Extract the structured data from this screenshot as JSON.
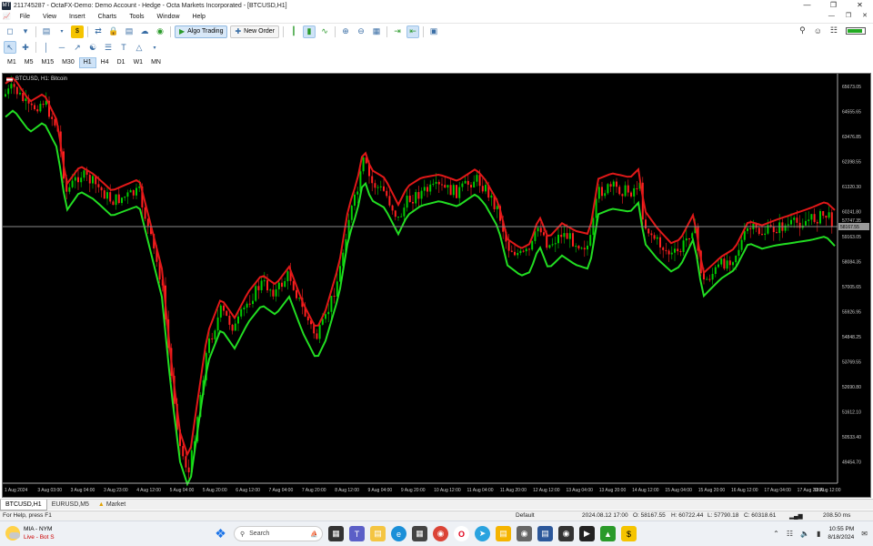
{
  "window": {
    "title": "211745287 - OctaFX-Demo: Demo Account - Hedge - Octa Markets Incorporated - [BTCUSD,H1]",
    "app_icon": "MT"
  },
  "menu": [
    "File",
    "View",
    "Insert",
    "Charts",
    "Tools",
    "Window",
    "Help"
  ],
  "toolbar": {
    "algo_trading": "Algo Trading",
    "new_order": "New Order"
  },
  "timeframes": [
    "M1",
    "M5",
    "M15",
    "M30",
    "H1",
    "H4",
    "D1",
    "W1",
    "MN"
  ],
  "active_timeframe": "H1",
  "chart": {
    "label": "BTCUSD, H1: Bitcoin",
    "price_labels": [
      "65673.05",
      "64555.65",
      "63476.85",
      "62398.55",
      "61320.30",
      "60241.80",
      "59163.05",
      "58084.35",
      "57005.65",
      "55926.95",
      "54848.25",
      "53769.55",
      "52690.80",
      "51612.10",
      "50533.40",
      "49454.70"
    ],
    "current_price": "58167.55",
    "current_price_line": "57747.35",
    "time_labels": [
      "1 Aug 2024",
      "3 Aug 03:00",
      "3 Aug 04:00",
      "3 Aug 23:00",
      "4 Aug 12:00",
      "5 Aug 04:00",
      "5 Aug 20:00",
      "6 Aug 12:00",
      "7 Aug 04:00",
      "7 Aug 20:00",
      "8 Aug 12:00",
      "9 Aug 04:00",
      "9 Aug 20:00",
      "10 Aug 12:00",
      "11 Aug 04:00",
      "11 Aug 20:00",
      "12 Aug 12:00",
      "13 Aug 04:00",
      "13 Aug 20:00",
      "14 Aug 12:00",
      "15 Aug 04:00",
      "15 Aug 20:00",
      "16 Aug 12:00",
      "17 Aug 04:00",
      "17 Aug 20:00",
      "18 Aug 12:00"
    ],
    "colors": {
      "background": "#000000",
      "bull": "#00cc00",
      "bear": "#ff2020",
      "ma_red": "#e01818",
      "ma_green": "#22dd22",
      "price_line": "#8a8a8a"
    }
  },
  "tabs": [
    "BTCUSD,H1",
    "EURUSD,M5",
    "Market"
  ],
  "status": {
    "help": "For Help, press F1",
    "profile": "Default",
    "time": "2024.08.12 17:00",
    "open": "O: 58167.55",
    "high": "H: 60722.44",
    "low": "L: 57790.18",
    "close": "C: 60318.61",
    "ping": "208.50 ms"
  },
  "taskbar": {
    "weather_title": "MIA - NYM",
    "weather_sub": "Live - Bot S",
    "search": "Search",
    "time": "10:55 PM",
    "date": "8/18/2024"
  }
}
